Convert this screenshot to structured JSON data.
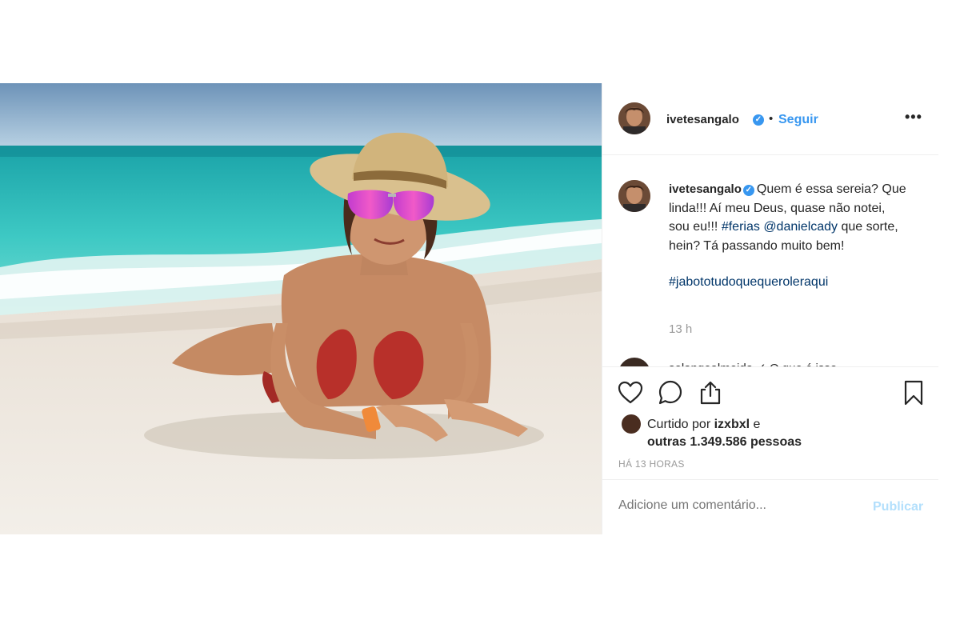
{
  "post": {
    "author": "ivetesangalo",
    "verified_mark": "✓",
    "separator": "•",
    "follow_label": "Seguir",
    "more_label": "•••",
    "caption": {
      "text_1": "Quem é essa sereia? Que linda!!! Aí meu Deus, quase não notei, sou eu!!! ",
      "hashtag_ferias": "#ferias",
      "mention": "@danielcady",
      "text_2": " que sorte, hein? Tá passando muito bem!",
      "hashtag_2": "#jabototudoquequeroleraqui"
    },
    "caption_time": "13 h",
    "next_comment": "solangealmeida ✓ O que é isso",
    "likes": {
      "prefix": "Curtido por ",
      "user": "izxbxl",
      "joiner": " e",
      "others": "outras 1.349.586 pessoas"
    },
    "timestamp": "HÁ 13 HORAS",
    "comment_placeholder": "Adicione um comentário...",
    "publish_label": "Publicar"
  },
  "icons": {
    "like": "heart-icon",
    "comment": "comment-bubble-icon",
    "share": "share-icon",
    "save": "bookmark-icon",
    "more": "more-dots-icon",
    "verified": "verified-badge-icon"
  },
  "colors": {
    "link_blue": "#3897f0",
    "hashtag": "#003569",
    "muted": "#999999",
    "publish_disabled": "#b2dffc"
  }
}
